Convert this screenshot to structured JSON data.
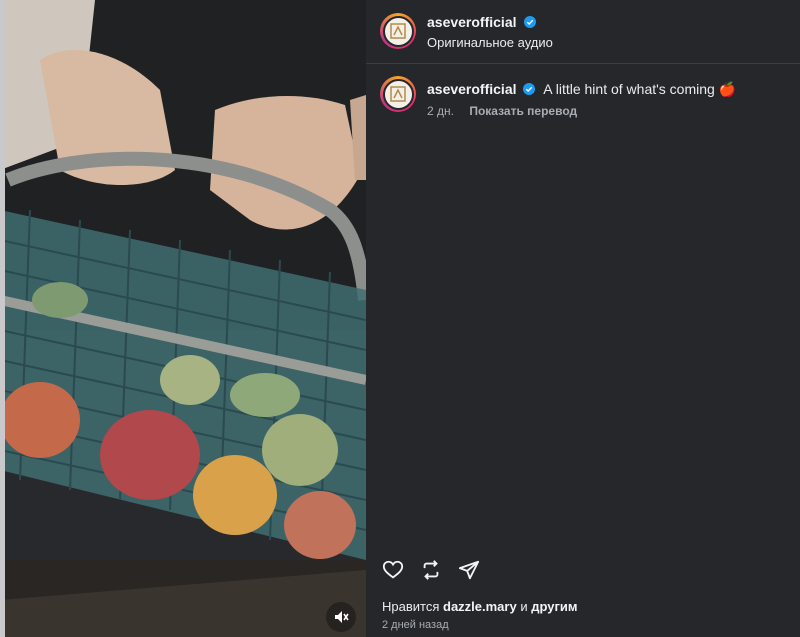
{
  "post": {
    "username": "aseverofficial",
    "audio_label": "Оригинальное аудио",
    "caption": "A little hint of what's coming 🍎",
    "caption_age": "2 дн.",
    "translate_label": "Показать перевод",
    "likes_prefix": "Нравится",
    "likes_user": "dazzle.mary",
    "likes_conj": "и",
    "likes_suffix": "другим",
    "posted_ago": "2 дней назад"
  },
  "icons": {
    "verified": "verified-badge-icon",
    "like": "heart-icon",
    "repost": "repost-icon",
    "share": "send-icon",
    "mute": "muted-speaker-icon"
  },
  "colors": {
    "background": "#25272b",
    "verified": "#1d9bf0",
    "muted_text": "#a8adb4"
  }
}
